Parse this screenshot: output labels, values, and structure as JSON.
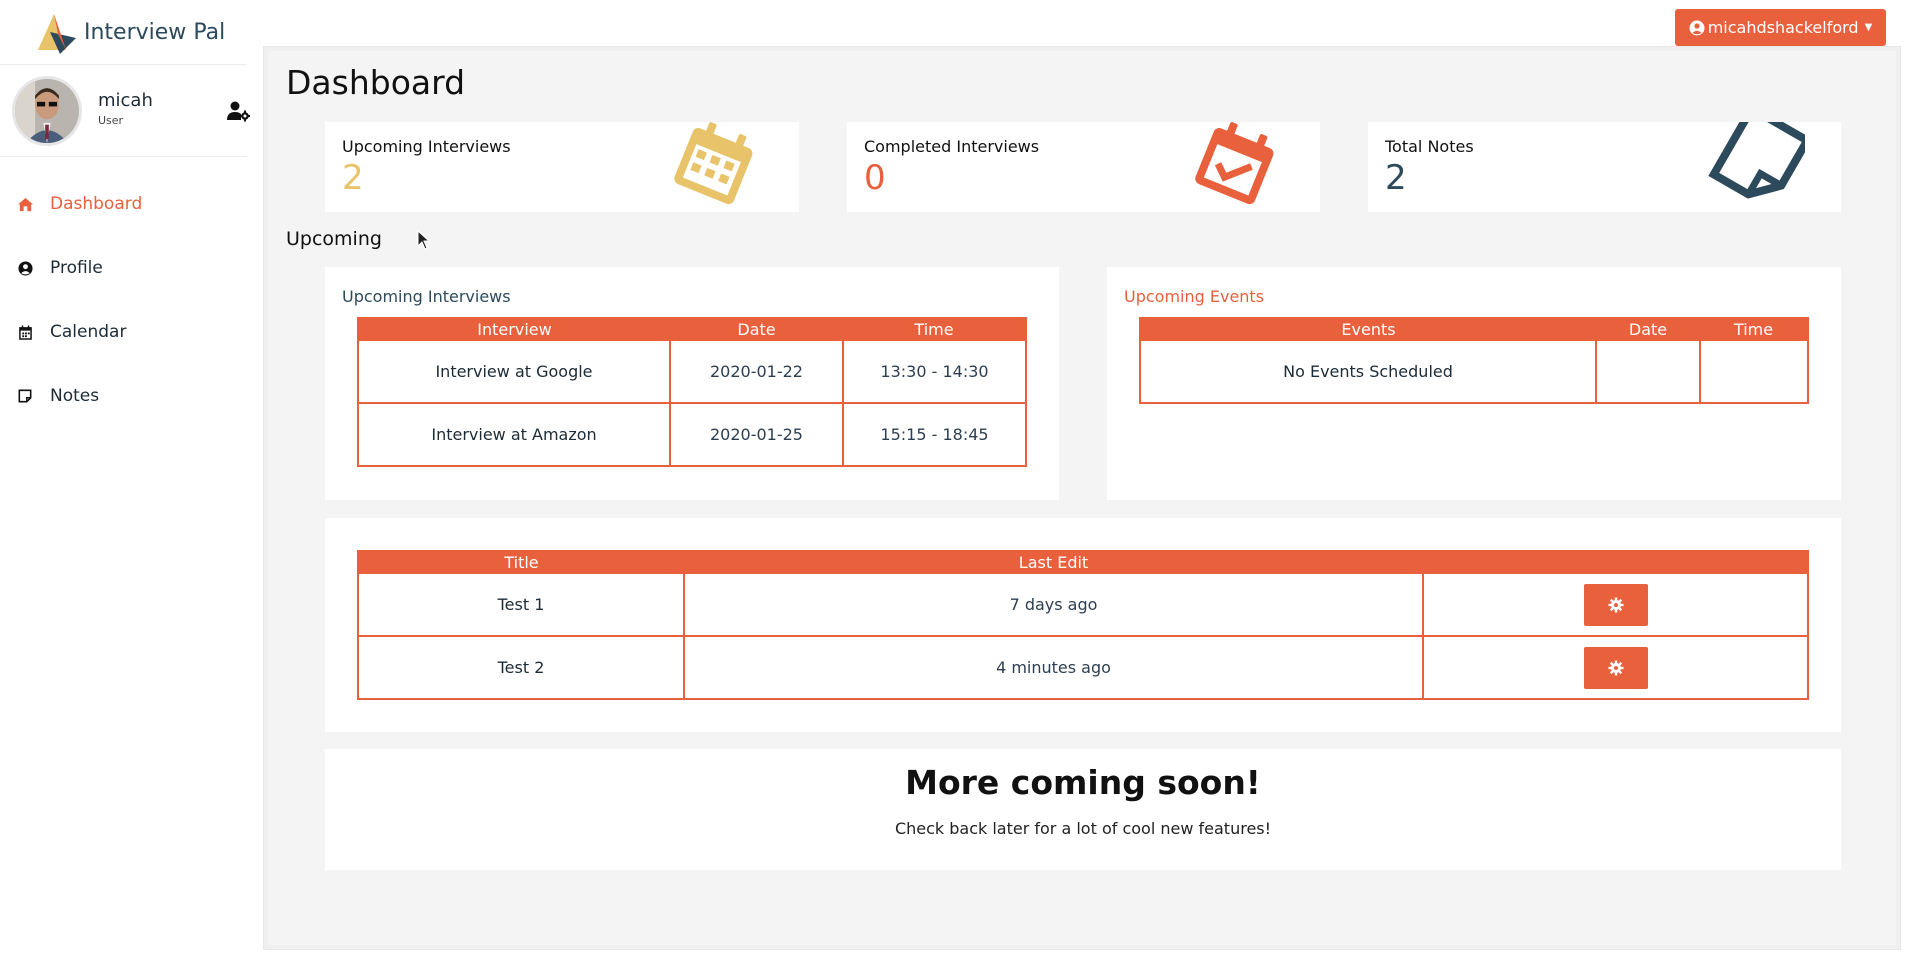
{
  "brand": {
    "name_part1": "Interview",
    "name_part2": "Pal"
  },
  "user": {
    "name": "micah",
    "role": "User",
    "username": "micahdshackelford"
  },
  "nav": [
    {
      "label": "Dashboard",
      "icon": "home-icon",
      "active": true
    },
    {
      "label": "Profile",
      "icon": "user-circle-icon",
      "active": false
    },
    {
      "label": "Calendar",
      "icon": "calendar-icon",
      "active": false
    },
    {
      "label": "Notes",
      "icon": "note-icon",
      "active": false
    }
  ],
  "page_title": "Dashboard",
  "stats": [
    {
      "title": "Upcoming Interviews",
      "value": "2",
      "color": "#e8c36a",
      "icon": "calendar-icon"
    },
    {
      "title": "Completed Interviews",
      "value": "0",
      "color": "#e8603c",
      "icon": "calendar-check-icon"
    },
    {
      "title": "Total Notes",
      "value": "2",
      "color": "#2c4a5c",
      "icon": "sticky-note-icon"
    }
  ],
  "upcoming_label": "Upcoming",
  "interviews_panel": {
    "title": "Upcoming Interviews",
    "headers": [
      "Interview",
      "Date",
      "Time"
    ],
    "rows": [
      {
        "interview": "Interview at Google",
        "date": "2020-01-22",
        "time": "13:30 - 14:30"
      },
      {
        "interview": "Interview at Amazon",
        "date": "2020-01-25",
        "time": "15:15 - 18:45"
      }
    ]
  },
  "events_panel": {
    "title": "Upcoming Events",
    "headers": [
      "Events",
      "Date",
      "Time"
    ],
    "empty_text": "No Events Scheduled"
  },
  "notes_table": {
    "headers": [
      "Title",
      "Last Edit",
      ""
    ],
    "rows": [
      {
        "title": "Test 1",
        "last_edit": "7 days ago"
      },
      {
        "title": "Test 2",
        "last_edit": "4 minutes ago"
      }
    ]
  },
  "coming_soon": {
    "title": "More coming soon!",
    "subtitle": "Check back later for a lot of cool new features!"
  },
  "colors": {
    "accent": "#e8603c",
    "gold": "#e8c36a",
    "navy": "#2c4a5c"
  }
}
